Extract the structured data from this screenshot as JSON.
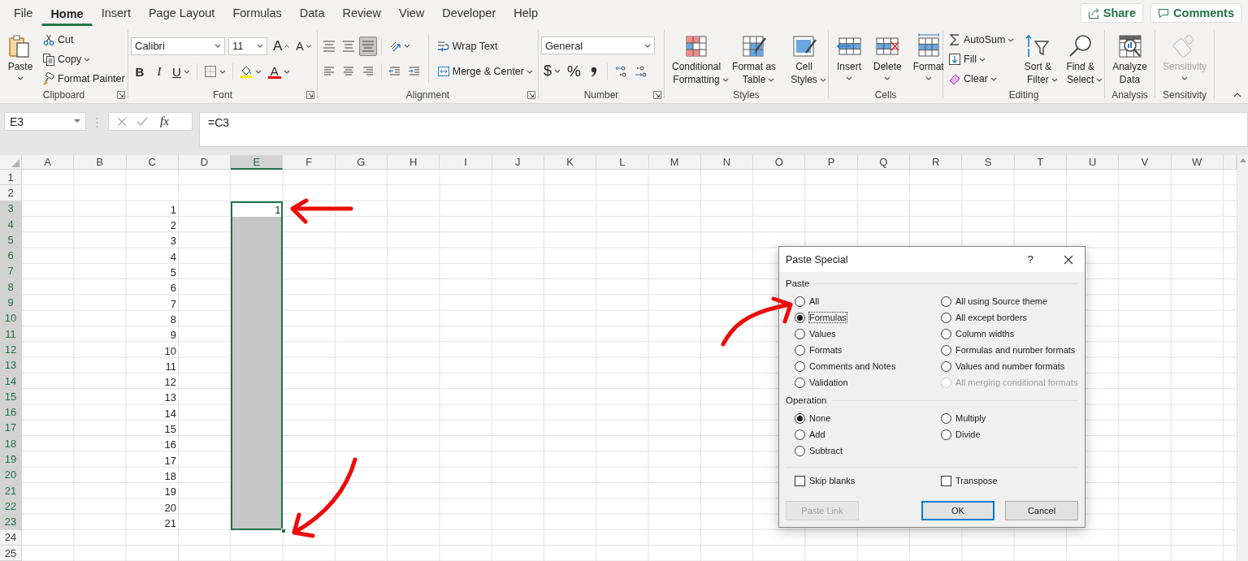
{
  "menu": {
    "tabs": [
      {
        "label": "File",
        "selected": false
      },
      {
        "label": "Home",
        "selected": true
      },
      {
        "label": "Insert",
        "selected": false
      },
      {
        "label": "Page Layout",
        "selected": false
      },
      {
        "label": "Formulas",
        "selected": false
      },
      {
        "label": "Data",
        "selected": false
      },
      {
        "label": "Review",
        "selected": false
      },
      {
        "label": "View",
        "selected": false
      },
      {
        "label": "Developer",
        "selected": false
      },
      {
        "label": "Help",
        "selected": false
      }
    ],
    "share": "Share",
    "comments": "Comments"
  },
  "ribbon": {
    "groups": [
      {
        "label": "Clipboard",
        "launcher": true,
        "parts": [
          {
            "kind": "large",
            "items": [
              {
                "kind": "paste",
                "label": "Paste",
                "dropdown": true
              }
            ]
          },
          {
            "kind": "stack",
            "lines": [
              [
                {
                  "kind": "cut",
                  "label": "Cut"
                }
              ],
              [
                {
                  "kind": "copy",
                  "label": "Copy",
                  "dropdown": true
                }
              ],
              [
                {
                  "kind": "format-painter",
                  "label": "Format Painter"
                }
              ]
            ]
          }
        ]
      },
      {
        "label": "Font",
        "launcher": true,
        "parts": [
          {
            "kind": "stack",
            "lines": [
              [
                {
                  "kind": "font-name",
                  "value": "Calibri"
                },
                {
                  "kind": "font-size",
                  "value": "11"
                },
                {
                  "kind": "grow-font",
                  "label": "A"
                },
                {
                  "kind": "shrink-font",
                  "label": "A"
                }
              ],
              [
                {
                  "kind": "bold",
                  "label": "B"
                },
                {
                  "kind": "italic",
                  "label": "I"
                },
                {
                  "kind": "underline",
                  "label": "U",
                  "dropdown": true
                },
                {
                  "kind": "separator"
                },
                {
                  "kind": "borders",
                  "dropdown": true
                },
                {
                  "kind": "separator"
                },
                {
                  "kind": "fill-color",
                  "dropdown": true
                },
                {
                  "kind": "font-color",
                  "label": "A",
                  "dropdown": true
                }
              ]
            ]
          }
        ]
      },
      {
        "label": "Alignment",
        "launcher": true,
        "parts": [
          {
            "kind": "stack",
            "lines": [
              [
                {
                  "kind": "align-top",
                  "selected": false
                },
                {
                  "kind": "align-middle",
                  "selected": false
                },
                {
                  "kind": "align-bottom",
                  "selected": true
                },
                {
                  "kind": "separator"
                },
                {
                  "kind": "orientation",
                  "dropdown": true
                }
              ],
              [
                {
                  "kind": "align-left",
                  "selected": false
                },
                {
                  "kind": "align-center",
                  "selected": false
                },
                {
                  "kind": "align-right",
                  "selected": false
                },
                {
                  "kind": "separator"
                },
                {
                  "kind": "outdent"
                },
                {
                  "kind": "indent"
                }
              ]
            ]
          },
          {
            "kind": "divider"
          },
          {
            "kind": "stack",
            "lines": [
              [
                {
                  "kind": "wrap-text",
                  "label": "Wrap Text"
                }
              ],
              [
                {
                  "kind": "merge",
                  "label": "Merge & Center",
                  "dropdown": true
                }
              ]
            ]
          }
        ]
      },
      {
        "label": "Number",
        "launcher": true,
        "parts": [
          {
            "kind": "stack",
            "lines": [
              [
                {
                  "kind": "number-format",
                  "value": "General"
                }
              ],
              [
                {
                  "kind": "currency",
                  "label": "$",
                  "dropdown": true
                },
                {
                  "kind": "percent",
                  "label": "%"
                },
                {
                  "kind": "comma"
                },
                {
                  "kind": "separator"
                },
                {
                  "kind": "inc-decimal"
                },
                {
                  "kind": "dec-decimal"
                }
              ]
            ]
          }
        ]
      },
      {
        "label": "Styles",
        "launcher": false,
        "parts": [
          {
            "kind": "large",
            "items": [
              {
                "kind": "conditional",
                "label": "Conditional Formatting",
                "dropdown": true
              },
              {
                "kind": "table-format",
                "label": "Format as Table",
                "dropdown": true
              },
              {
                "kind": "cell-styles",
                "label": "Cell Styles",
                "dropdown": true
              }
            ]
          }
        ]
      },
      {
        "label": "Cells",
        "launcher": false,
        "parts": [
          {
            "kind": "large",
            "items": [
              {
                "kind": "insert",
                "label": "Insert",
                "dropdown": true
              },
              {
                "kind": "delete",
                "label": "Delete",
                "dropdown": true
              },
              {
                "kind": "format",
                "label": "Format",
                "dropdown": true
              }
            ]
          }
        ]
      },
      {
        "label": "Editing",
        "launcher": false,
        "parts": [
          {
            "kind": "stack",
            "lines": [
              [
                {
                  "kind": "autosum",
                  "label": "AutoSum",
                  "dropdown": true
                }
              ],
              [
                {
                  "kind": "fill",
                  "label": "Fill",
                  "dropdown": true
                }
              ],
              [
                {
                  "kind": "clear",
                  "label": "Clear",
                  "dropdown": true
                }
              ]
            ]
          },
          {
            "kind": "large",
            "items": [
              {
                "kind": "sort",
                "label": "Sort & Filter",
                "dropdown": true
              },
              {
                "kind": "find",
                "label": "Find & Select",
                "dropdown": true
              }
            ]
          }
        ]
      },
      {
        "label": "Analysis",
        "launcher": false,
        "parts": [
          {
            "kind": "large",
            "items": [
              {
                "kind": "analyze",
                "label": "Analyze Data"
              }
            ]
          }
        ]
      },
      {
        "label": "Sensitivity",
        "launcher": false,
        "parts": [
          {
            "kind": "large",
            "items": [
              {
                "kind": "sensitivity",
                "label": "Sensitivity",
                "dropdown": true,
                "disabled": true
              }
            ]
          }
        ]
      }
    ]
  },
  "formula_bar": {
    "name_box": "E3",
    "function_button": "fx",
    "formula": "=C3"
  },
  "sheet": {
    "columns": [
      {
        "label": "A",
        "selected": false
      },
      {
        "label": "B",
        "selected": false
      },
      {
        "label": "C",
        "selected": false
      },
      {
        "label": "D",
        "selected": false
      },
      {
        "label": "E",
        "selected": true
      },
      {
        "label": "F",
        "selected": false
      },
      {
        "label": "G",
        "selected": false
      },
      {
        "label": "H",
        "selected": false
      },
      {
        "label": "I",
        "selected": false
      },
      {
        "label": "J",
        "selected": false
      },
      {
        "label": "K",
        "selected": false
      },
      {
        "label": "L",
        "selected": false
      },
      {
        "label": "M",
        "selected": false
      },
      {
        "label": "N",
        "selected": false
      },
      {
        "label": "O",
        "selected": false
      },
      {
        "label": "P",
        "selected": false
      },
      {
        "label": "Q",
        "selected": false
      },
      {
        "label": "R",
        "selected": false
      },
      {
        "label": "S",
        "selected": false
      },
      {
        "label": "T",
        "selected": false
      },
      {
        "label": "U",
        "selected": false
      },
      {
        "label": "V",
        "selected": false
      },
      {
        "label": "W",
        "selected": false
      }
    ],
    "rows": [
      {
        "label": "1",
        "selected": false
      },
      {
        "label": "2",
        "selected": false
      },
      {
        "label": "3",
        "selected": true,
        "cells": [
          {
            "selected": false
          },
          {
            "selected": false
          },
          {
            "value": "1",
            "selected": false
          },
          {
            "selected": false
          },
          {
            "value": "1",
            "selected": true,
            "active": true
          }
        ]
      },
      {
        "label": "4",
        "selected": true,
        "cells": [
          {
            "selected": false
          },
          {
            "selected": false
          },
          {
            "value": "2",
            "selected": false
          },
          {
            "selected": false
          },
          {
            "selected": true,
            "active": false
          }
        ]
      },
      {
        "label": "5",
        "selected": true,
        "cells": [
          {
            "selected": false
          },
          {
            "selected": false
          },
          {
            "value": "3",
            "selected": false
          },
          {
            "selected": false
          },
          {
            "selected": true,
            "active": false
          }
        ]
      },
      {
        "label": "6",
        "selected": true,
        "cells": [
          {
            "selected": false
          },
          {
            "selected": false
          },
          {
            "value": "4",
            "selected": false
          },
          {
            "selected": false
          },
          {
            "selected": true,
            "active": false
          }
        ]
      },
      {
        "label": "7",
        "selected": true,
        "cells": [
          {
            "selected": false
          },
          {
            "selected": false
          },
          {
            "value": "5",
            "selected": false
          },
          {
            "selected": false
          },
          {
            "selected": true,
            "active": false
          }
        ]
      },
      {
        "label": "8",
        "selected": true,
        "cells": [
          {
            "selected": false
          },
          {
            "selected": false
          },
          {
            "value": "6",
            "selected": false
          },
          {
            "selected": false
          },
          {
            "selected": true,
            "active": false
          }
        ]
      },
      {
        "label": "9",
        "selected": true,
        "cells": [
          {
            "selected": false
          },
          {
            "selected": false
          },
          {
            "value": "7",
            "selected": false
          },
          {
            "selected": false
          },
          {
            "selected": true,
            "active": false
          }
        ]
      },
      {
        "label": "10",
        "selected": true,
        "cells": [
          {
            "selected": false
          },
          {
            "selected": false
          },
          {
            "value": "8",
            "selected": false
          },
          {
            "selected": false
          },
          {
            "selected": true,
            "active": false
          }
        ]
      },
      {
        "label": "11",
        "selected": true,
        "cells": [
          {
            "selected": false
          },
          {
            "selected": false
          },
          {
            "value": "9",
            "selected": false
          },
          {
            "selected": false
          },
          {
            "selected": true,
            "active": false
          }
        ]
      },
      {
        "label": "12",
        "selected": true,
        "cells": [
          {
            "selected": false
          },
          {
            "selected": false
          },
          {
            "value": "10",
            "selected": false
          },
          {
            "selected": false
          },
          {
            "selected": true,
            "active": false
          }
        ]
      },
      {
        "label": "13",
        "selected": true,
        "cells": [
          {
            "selected": false
          },
          {
            "selected": false
          },
          {
            "value": "11",
            "selected": false
          },
          {
            "selected": false
          },
          {
            "selected": true,
            "active": false
          }
        ]
      },
      {
        "label": "14",
        "selected": true,
        "cells": [
          {
            "selected": false
          },
          {
            "selected": false
          },
          {
            "value": "12",
            "selected": false
          },
          {
            "selected": false
          },
          {
            "selected": true,
            "active": false
          }
        ]
      },
      {
        "label": "15",
        "selected": true,
        "cells": [
          {
            "selected": false
          },
          {
            "selected": false
          },
          {
            "value": "13",
            "selected": false
          },
          {
            "selected": false
          },
          {
            "selected": true,
            "active": false
          }
        ]
      },
      {
        "label": "16",
        "selected": true,
        "cells": [
          {
            "selected": false
          },
          {
            "selected": false
          },
          {
            "value": "14",
            "selected": false
          },
          {
            "selected": false
          },
          {
            "selected": true,
            "active": false
          }
        ]
      },
      {
        "label": "17",
        "selected": true,
        "cells": [
          {
            "selected": false
          },
          {
            "selected": false
          },
          {
            "value": "15",
            "selected": false
          },
          {
            "selected": false
          },
          {
            "selected": true,
            "active": false
          }
        ]
      },
      {
        "label": "18",
        "selected": true,
        "cells": [
          {
            "selected": false
          },
          {
            "selected": false
          },
          {
            "value": "16",
            "selected": false
          },
          {
            "selected": false
          },
          {
            "selected": true,
            "active": false
          }
        ]
      },
      {
        "label": "19",
        "selected": true,
        "cells": [
          {
            "selected": false
          },
          {
            "selected": false
          },
          {
            "value": "17",
            "selected": false
          },
          {
            "selected": false
          },
          {
            "selected": true,
            "active": false
          }
        ]
      },
      {
        "label": "20",
        "selected": true,
        "cells": [
          {
            "selected": false
          },
          {
            "selected": false
          },
          {
            "value": "18",
            "selected": false
          },
          {
            "selected": false
          },
          {
            "selected": true,
            "active": false
          }
        ]
      },
      {
        "label": "21",
        "selected": true,
        "cells": [
          {
            "selected": false
          },
          {
            "selected": false
          },
          {
            "value": "19",
            "selected": false
          },
          {
            "selected": false
          },
          {
            "selected": true,
            "active": false
          }
        ]
      },
      {
        "label": "22",
        "selected": true,
        "cells": [
          {
            "selected": false
          },
          {
            "selected": false
          },
          {
            "value": "20",
            "selected": false
          },
          {
            "selected": false
          },
          {
            "selected": true,
            "active": false
          }
        ]
      },
      {
        "label": "23",
        "selected": true,
        "cells": [
          {
            "selected": false
          },
          {
            "selected": false
          },
          {
            "value": "21",
            "selected": false
          },
          {
            "selected": false
          },
          {
            "selected": true,
            "active": false
          }
        ]
      },
      {
        "label": "24",
        "selected": false
      },
      {
        "label": "25",
        "selected": false
      }
    ]
  },
  "dialog": {
    "title": "Paste Special",
    "help": "?",
    "sections": [
      {
        "label": "Paste",
        "options": [
          {
            "label": "All",
            "selected": false,
            "disabled": false,
            "focused": false
          },
          {
            "label": "Formulas",
            "selected": true,
            "disabled": false,
            "focused": true
          },
          {
            "label": "Values",
            "selected": false,
            "disabled": false,
            "focused": false
          },
          {
            "label": "Formats",
            "selected": false,
            "disabled": false,
            "focused": false
          },
          {
            "label": "Comments and Notes",
            "selected": false,
            "disabled": false,
            "focused": false
          },
          {
            "label": "Validation",
            "selected": false,
            "disabled": false,
            "focused": false
          },
          {
            "label": "All using Source theme",
            "selected": false,
            "disabled": false,
            "focused": false
          },
          {
            "label": "All except borders",
            "selected": false,
            "disabled": false,
            "focused": false
          },
          {
            "label": "Column widths",
            "selected": false,
            "disabled": false,
            "focused": false
          },
          {
            "label": "Formulas and number formats",
            "selected": false,
            "disabled": false,
            "focused": false
          },
          {
            "label": "Values and number formats",
            "selected": false,
            "disabled": false,
            "focused": false
          },
          {
            "label": "All merging conditional formats",
            "selected": false,
            "disabled": true,
            "focused": false
          }
        ]
      },
      {
        "label": "Operation",
        "options": [
          {
            "label": "None",
            "selected": true,
            "disabled": false,
            "focused": false
          },
          {
            "label": "Add",
            "selected": false,
            "disabled": false,
            "focused": false
          },
          {
            "label": "Subtract",
            "selected": false,
            "disabled": false,
            "focused": false
          },
          {
            "label": "Multiply",
            "selected": false,
            "disabled": false,
            "focused": false
          },
          {
            "label": "Divide",
            "selected": false,
            "disabled": false,
            "focused": false
          }
        ]
      }
    ],
    "checkboxes": [
      {
        "label": "Skip blanks",
        "checked": false
      },
      {
        "label": "Transpose",
        "checked": false
      }
    ],
    "buttons": [
      {
        "label": "Paste Link",
        "disabled": true,
        "default": false
      },
      {
        "label": "OK",
        "disabled": false,
        "default": true
      },
      {
        "label": "Cancel",
        "disabled": false,
        "default": false
      }
    ]
  }
}
